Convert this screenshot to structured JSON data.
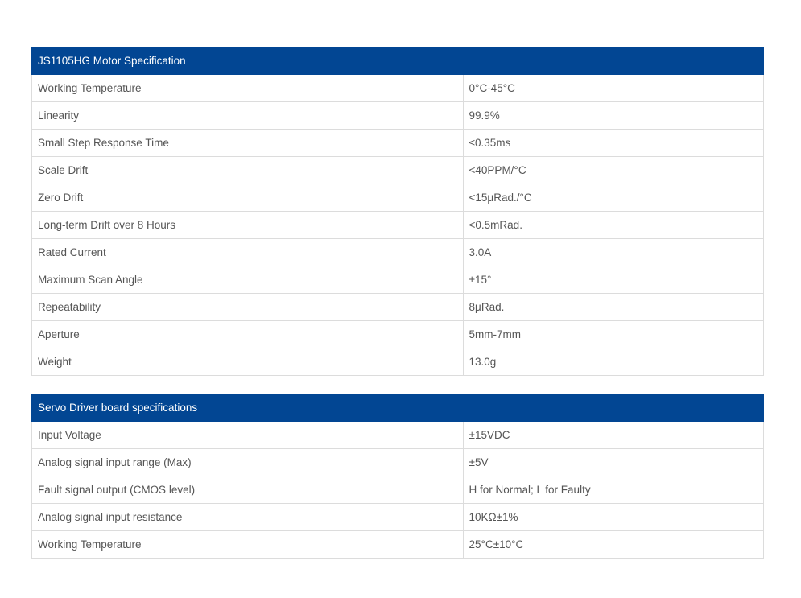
{
  "motor_spec": {
    "title": "JS1105HG Motor Specification",
    "rows": [
      {
        "label": "Working Temperature",
        "value": "0°C-45°C"
      },
      {
        "label": "Linearity",
        "value": "99.9%"
      },
      {
        "label": "Small Step Response Time",
        "value": "≤0.35ms"
      },
      {
        "label": "Scale Drift",
        "value": "<40PPM/°C"
      },
      {
        "label": "Zero Drift",
        "value": "<15μRad./°C"
      },
      {
        "label": "Long-term Drift over 8 Hours",
        "value": "<0.5mRad."
      },
      {
        "label": "Rated Current",
        "value": "3.0A"
      },
      {
        "label": "Maximum Scan Angle",
        "value": "±15°"
      },
      {
        "label": "Repeatability",
        "value": "8μRad."
      },
      {
        "label": "Aperture",
        "value": "5mm-7mm"
      },
      {
        "label": "Weight",
        "value": "13.0g"
      }
    ]
  },
  "driver_spec": {
    "title": "Servo Driver board specifications",
    "rows": [
      {
        "label": "Input Voltage",
        "value": "±15VDC"
      },
      {
        "label": "Analog signal input range (Max)",
        "value": "±5V"
      },
      {
        "label": "Fault signal output (CMOS level)",
        "value": "H for Normal; L for Faulty"
      },
      {
        "label": "Analog signal input resistance",
        "value": "10KΩ±1%"
      },
      {
        "label": "Working Temperature",
        "value": "25°C±10°C"
      }
    ]
  },
  "colors": {
    "header_background": "#024693",
    "header_text": "#ffffff",
    "border": "#dcdcdc",
    "cell_text": "#555555"
  }
}
